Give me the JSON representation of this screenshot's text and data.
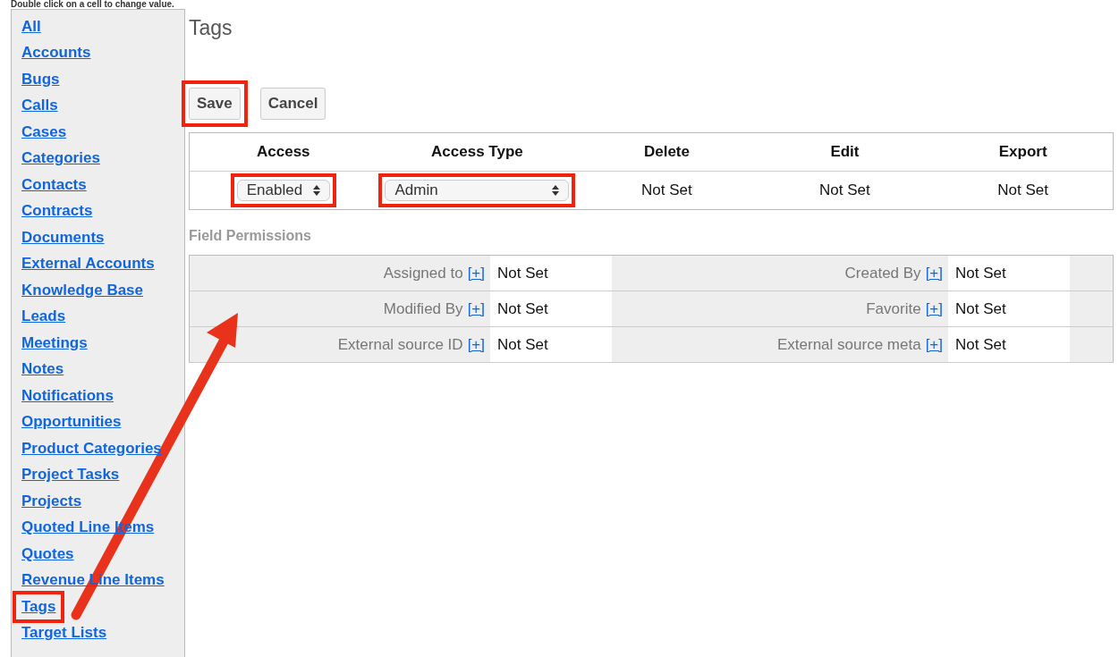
{
  "hint": "Double click on a cell to change value.",
  "sidebar": {
    "items": [
      {
        "label": "All",
        "highlighted": false
      },
      {
        "label": "Accounts",
        "highlighted": false
      },
      {
        "label": "Bugs",
        "highlighted": false
      },
      {
        "label": "Calls",
        "highlighted": false
      },
      {
        "label": "Cases",
        "highlighted": false
      },
      {
        "label": "Categories",
        "highlighted": false
      },
      {
        "label": "Contacts",
        "highlighted": false
      },
      {
        "label": "Contracts",
        "highlighted": false
      },
      {
        "label": "Documents",
        "highlighted": false
      },
      {
        "label": "External Accounts",
        "highlighted": false
      },
      {
        "label": "Knowledge Base",
        "highlighted": false
      },
      {
        "label": "Leads",
        "highlighted": false
      },
      {
        "label": "Meetings",
        "highlighted": false
      },
      {
        "label": "Notes",
        "highlighted": false
      },
      {
        "label": "Notifications",
        "highlighted": false
      },
      {
        "label": "Opportunities",
        "highlighted": false
      },
      {
        "label": "Product Categories",
        "highlighted": false
      },
      {
        "label": "Project Tasks",
        "highlighted": false
      },
      {
        "label": "Projects",
        "highlighted": false
      },
      {
        "label": "Quoted Line Items",
        "highlighted": false
      },
      {
        "label": "Quotes",
        "highlighted": false
      },
      {
        "label": "Revenue Line Items",
        "highlighted": false
      },
      {
        "label": "Tags",
        "highlighted": true
      },
      {
        "label": "Target Lists",
        "highlighted": false
      }
    ]
  },
  "title": "Tags",
  "buttons": [
    {
      "label": "Save",
      "highlighted": true
    },
    {
      "label": "Cancel",
      "highlighted": false
    }
  ],
  "table": {
    "columns": [
      "Access",
      "Access Type",
      "Delete",
      "Edit",
      "Export"
    ],
    "row": [
      {
        "kind": "select",
        "value": "Enabled",
        "highlighted": true
      },
      {
        "kind": "select",
        "value": "Admin",
        "highlighted": true
      },
      {
        "kind": "text",
        "value": "Not Set"
      },
      {
        "kind": "text",
        "value": "Not Set"
      },
      {
        "kind": "text",
        "value": "Not Set"
      }
    ]
  },
  "field_permissions": {
    "heading": "Field Permissions",
    "rows": [
      [
        {
          "label": "Assigned to",
          "link": "[+]",
          "value": "Not Set"
        },
        {
          "label": "Created By",
          "link": "[+]",
          "value": "Not Set"
        }
      ],
      [
        {
          "label": "Modified By",
          "link": "[+]",
          "value": "Not Set"
        },
        {
          "label": "Favorite",
          "link": "[+]",
          "value": "Not Set"
        }
      ],
      [
        {
          "label": "External source ID",
          "link": "[+]",
          "value": "Not Set"
        },
        {
          "label": "External source meta",
          "link": "[+]",
          "value": "Not Set"
        }
      ]
    ]
  }
}
